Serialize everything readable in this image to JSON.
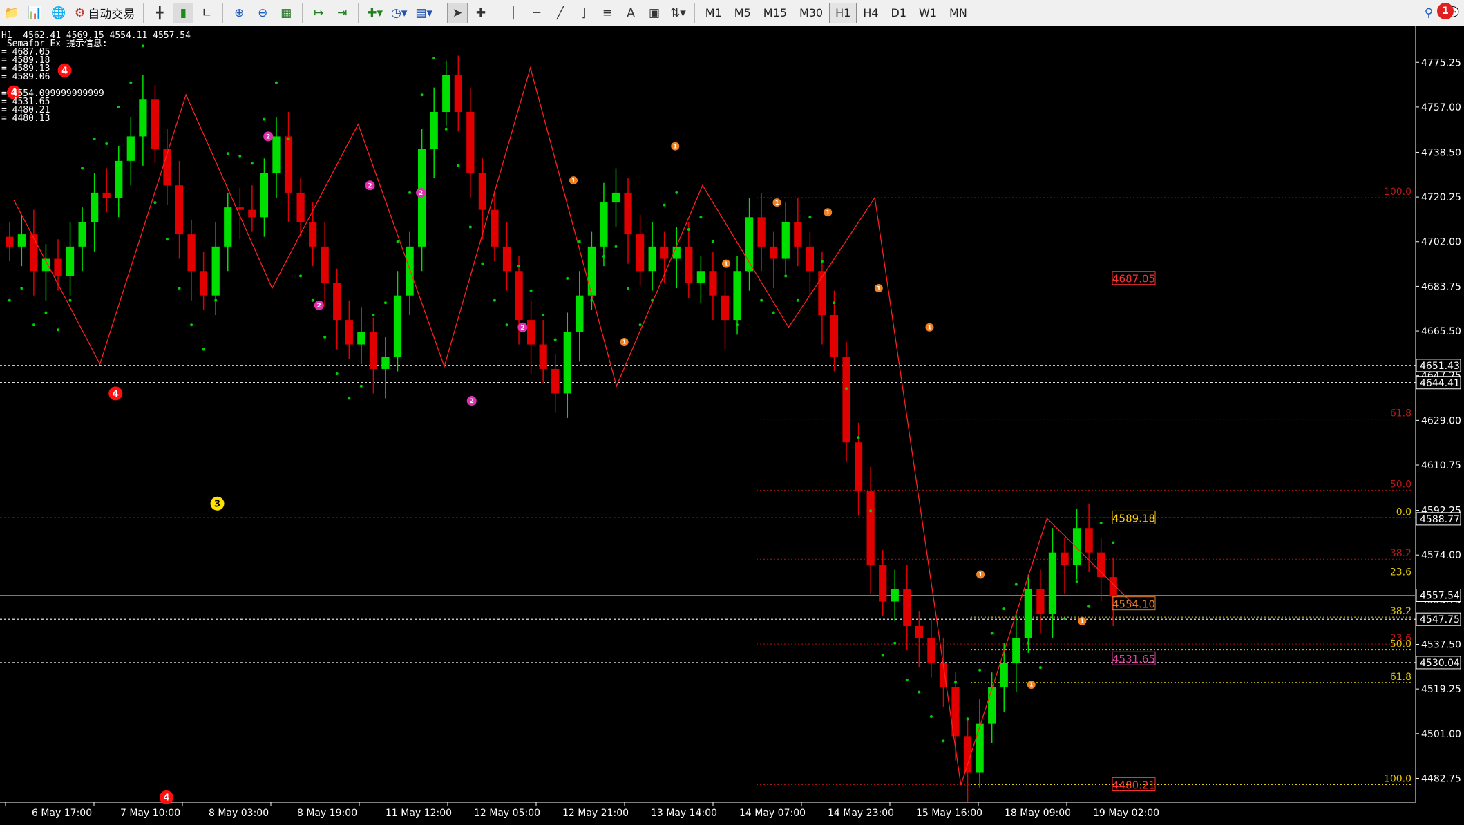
{
  "toolbar": {
    "auto_trading_label": "自动交易",
    "timeframes": [
      "M1",
      "M5",
      "M15",
      "M30",
      "H1",
      "H4",
      "D1",
      "W1",
      "MN"
    ],
    "active_timeframe": "H1",
    "alert_count": "1"
  },
  "info_lines": [
    "H1  4562.41 4569.15 4554.11 4557.54",
    " Semafor_Ex 提示信息:",
    "= 4687.05",
    "= 4589.18",
    "= 4589.13",
    "= 4589.06",
    "",
    "= 4554.099999999999",
    "= 4531.65",
    "= 4480.21",
    "= 4480.13"
  ],
  "colors": {
    "bg": "#000000",
    "bull": "#00e000",
    "bear": "#e00000",
    "sar": "#00d000",
    "grid_white": "#ffffff",
    "fib_red": "#b01010",
    "fib_yellow": "#e0d000",
    "zigzag_red": "#ff2020"
  },
  "chart_data": {
    "type": "candlestick",
    "symbol_period": "H1",
    "ohlc": {
      "open": 4562.41,
      "high": 4569.15,
      "low": 4554.11,
      "close": 4557.54
    },
    "price_axis": {
      "min": 4473,
      "max": 4790,
      "ticks": [
        "4775.25",
        "4757.00",
        "4738.50",
        "4720.25",
        "4702.00",
        "4683.75",
        "4665.50",
        "4647.25",
        "4629.00",
        "4610.75",
        "4592.25",
        "4574.00",
        "4555.75",
        "4537.50",
        "4519.25",
        "4501.00",
        "4482.75"
      ]
    },
    "time_axis": [
      "6 May 17:00",
      "7 May 10:00",
      "8 May 03:00",
      "8 May 19:00",
      "11 May 12:00",
      "12 May 05:00",
      "12 May 21:00",
      "13 May 14:00",
      "14 May 07:00",
      "14 May 23:00",
      "15 May 16:00",
      "18 May 09:00",
      "19 May 02:00"
    ],
    "price_labels": [
      {
        "text": "4651.43",
        "price": 4651.43,
        "style": "white"
      },
      {
        "text": "4644.41",
        "price": 4644.41,
        "style": "white"
      },
      {
        "text": "4588.77",
        "price": 4588.77,
        "style": "white"
      },
      {
        "text": "4557.54",
        "price": 4557.54,
        "style": "white"
      },
      {
        "text": "4547.75",
        "price": 4547.75,
        "style": "white"
      },
      {
        "text": "4530.04",
        "price": 4530.04,
        "style": "white"
      }
    ],
    "value_labels": [
      {
        "text": "4687.05",
        "price": 4687.05,
        "color": "#ff3030"
      },
      {
        "text": "4589.18",
        "price": 4589.18,
        "color": "#ffd000"
      },
      {
        "text": "4554.10",
        "price": 4554.1,
        "color": "#e08030"
      },
      {
        "text": "4531.65",
        "price": 4531.65,
        "color": "#e040a0"
      },
      {
        "text": "4480.21",
        "price": 4480.21,
        "color": "#ff3030"
      }
    ],
    "hlines": [
      {
        "price": 4651.43,
        "color": "#ffffff"
      },
      {
        "price": 4644.41,
        "color": "#ffffff"
      },
      {
        "price": 4589.18,
        "color": "#ffffff"
      },
      {
        "price": 4547.75,
        "color": "#ffffff"
      },
      {
        "price": 4530.04,
        "color": "#ffffff"
      }
    ],
    "fib_red": [
      {
        "label": "100.0",
        "price": 4720.0
      },
      {
        "label": "61.8",
        "price": 4629.5
      },
      {
        "label": "50.0",
        "price": 4600.5
      },
      {
        "label": "38.2",
        "price": 4572.3
      },
      {
        "label": "23.6",
        "price": 4537.6
      },
      {
        "label": "0.0",
        "price": 4480.2
      }
    ],
    "fib_yellow": [
      {
        "label": "0.0",
        "price": 4589.2
      },
      {
        "label": "23.6",
        "price": 4564.6
      },
      {
        "label": "38.2",
        "price": 4548.6
      },
      {
        "label": "50.0",
        "price": 4535.2
      },
      {
        "label": "61.8",
        "price": 4521.9
      },
      {
        "label": "100.0",
        "price": 4480.2
      }
    ],
    "semafor_markers": [
      {
        "label": "4",
        "price": 4763,
        "color": "#ff1010",
        "size": "big"
      },
      {
        "label": "4",
        "price": 4772,
        "color": "#ff1010",
        "size": "big"
      },
      {
        "label": "4",
        "price": 4640,
        "color": "#ff1010",
        "size": "big"
      },
      {
        "label": "4",
        "price": 4475,
        "color": "#ff1010",
        "size": "big"
      },
      {
        "label": "3",
        "price": 4595,
        "color": "#ffe000",
        "size": "big"
      },
      {
        "label": "2",
        "price": 4745,
        "color": "#e030b0",
        "size": "mid"
      },
      {
        "label": "2",
        "price": 4676,
        "color": "#e030b0",
        "size": "mid"
      },
      {
        "label": "2",
        "price": 4725,
        "color": "#e030b0",
        "size": "mid"
      },
      {
        "label": "2",
        "price": 4722,
        "color": "#e030b0",
        "size": "mid"
      },
      {
        "label": "2",
        "price": 4637,
        "color": "#e030b0",
        "size": "mid"
      },
      {
        "label": "2",
        "price": 4667,
        "color": "#e030b0",
        "size": "mid"
      },
      {
        "label": "1",
        "price": 4727,
        "color": "#f08020",
        "size": "small"
      },
      {
        "label": "1",
        "price": 4661,
        "color": "#f08020",
        "size": "small"
      },
      {
        "label": "1",
        "price": 4741,
        "color": "#f08020",
        "size": "small"
      },
      {
        "label": "1",
        "price": 4693,
        "color": "#f08020",
        "size": "small"
      },
      {
        "label": "1",
        "price": 4718,
        "color": "#f08020",
        "size": "small"
      },
      {
        "label": "1",
        "price": 4714,
        "color": "#f08020",
        "size": "small"
      },
      {
        "label": "1",
        "price": 4683,
        "color": "#f08020",
        "size": "small"
      },
      {
        "label": "1",
        "price": 4667,
        "color": "#f08020",
        "size": "small"
      },
      {
        "label": "1",
        "price": 4566,
        "color": "#f08020",
        "size": "small"
      },
      {
        "label": "1",
        "price": 4521,
        "color": "#f08020",
        "size": "small"
      },
      {
        "label": "1",
        "price": 4547,
        "color": "#f08020",
        "size": "small"
      }
    ],
    "zigzag_points": [
      4719,
      4652,
      4762,
      4683,
      4750,
      4651,
      4773,
      4643,
      4725,
      4667,
      4720,
      4480,
      4589,
      4554
    ],
    "candle_closes": [
      4700,
      4705,
      4690,
      4695,
      4688,
      4700,
      4710,
      4722,
      4720,
      4735,
      4745,
      4760,
      4740,
      4725,
      4705,
      4690,
      4680,
      4700,
      4716,
      4715,
      4712,
      4730,
      4745,
      4722,
      4710,
      4700,
      4685,
      4670,
      4660,
      4665,
      4650,
      4655,
      4680,
      4700,
      4740,
      4755,
      4770,
      4755,
      4730,
      4715,
      4700,
      4690,
      4670,
      4660,
      4650,
      4640,
      4665,
      4680,
      4700,
      4718,
      4722,
      4705,
      4690,
      4700,
      4695,
      4700,
      4685,
      4690,
      4680,
      4670,
      4690,
      4712,
      4700,
      4695,
      4710,
      4700,
      4690,
      4672,
      4655,
      4620,
      4600,
      4570,
      4555,
      4560,
      4545,
      4540,
      4530,
      4520,
      4500,
      4485,
      4505,
      4520,
      4530,
      4540,
      4560,
      4550,
      4575,
      4570,
      4585,
      4575,
      4565,
      4557
    ]
  }
}
